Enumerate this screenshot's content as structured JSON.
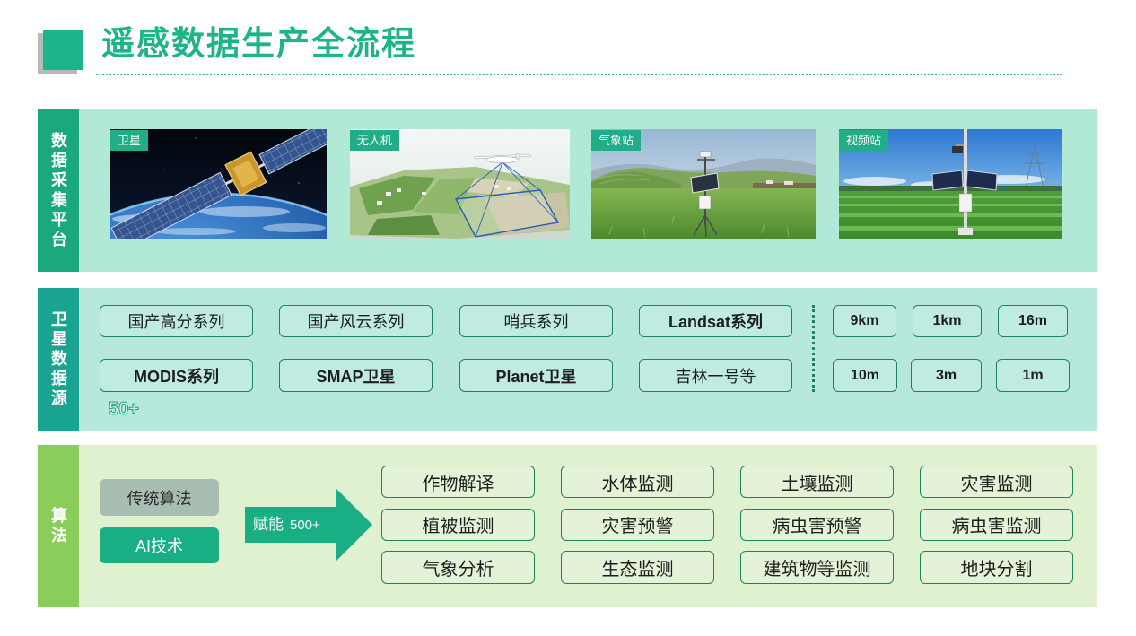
{
  "title": "遥感数据生产全流程",
  "colors": {
    "accent": "#1db48a",
    "band-acquisition": "#1aa97c",
    "band-sources": "#19a391",
    "band-algorithms": "#8bcd5b",
    "bg-acquisition": "#b2e8d6",
    "bg-sources": "#b6e8dc",
    "bg-algorithms": "#dff1cf",
    "box-border": "#1d8459",
    "tag-fill": "#1fae86",
    "traditional-fill": "#a8beb3",
    "ai-fill": "#1aae85"
  },
  "acquisition": {
    "label": "数据采集平台",
    "platforms": [
      "卫星",
      "无人机",
      "气象站",
      "视频站"
    ]
  },
  "sources": {
    "label": "卫星数据源",
    "series": [
      "国产高分系列",
      "国产风云系列",
      "哨兵系列",
      "Landsat系列",
      "MODIS系列",
      "SMAP卫星",
      "Planet卫星",
      "吉林一号等"
    ],
    "count": "50+",
    "resolutions": [
      "9km",
      "1km",
      "16m",
      "10m",
      "3m",
      "1m"
    ]
  },
  "algorithms": {
    "label": "算法",
    "methods": [
      "传统算法",
      "AI技术"
    ],
    "enable": {
      "label": "赋能",
      "count": "500+"
    },
    "applications": [
      "作物解译",
      "水体监测",
      "土壤监测",
      "灾害监测",
      "植被监测",
      "灾害预警",
      "病虫害预警",
      "病虫害监测",
      "气象分析",
      "生态监测",
      "建筑物等监测",
      "地块分割"
    ]
  }
}
